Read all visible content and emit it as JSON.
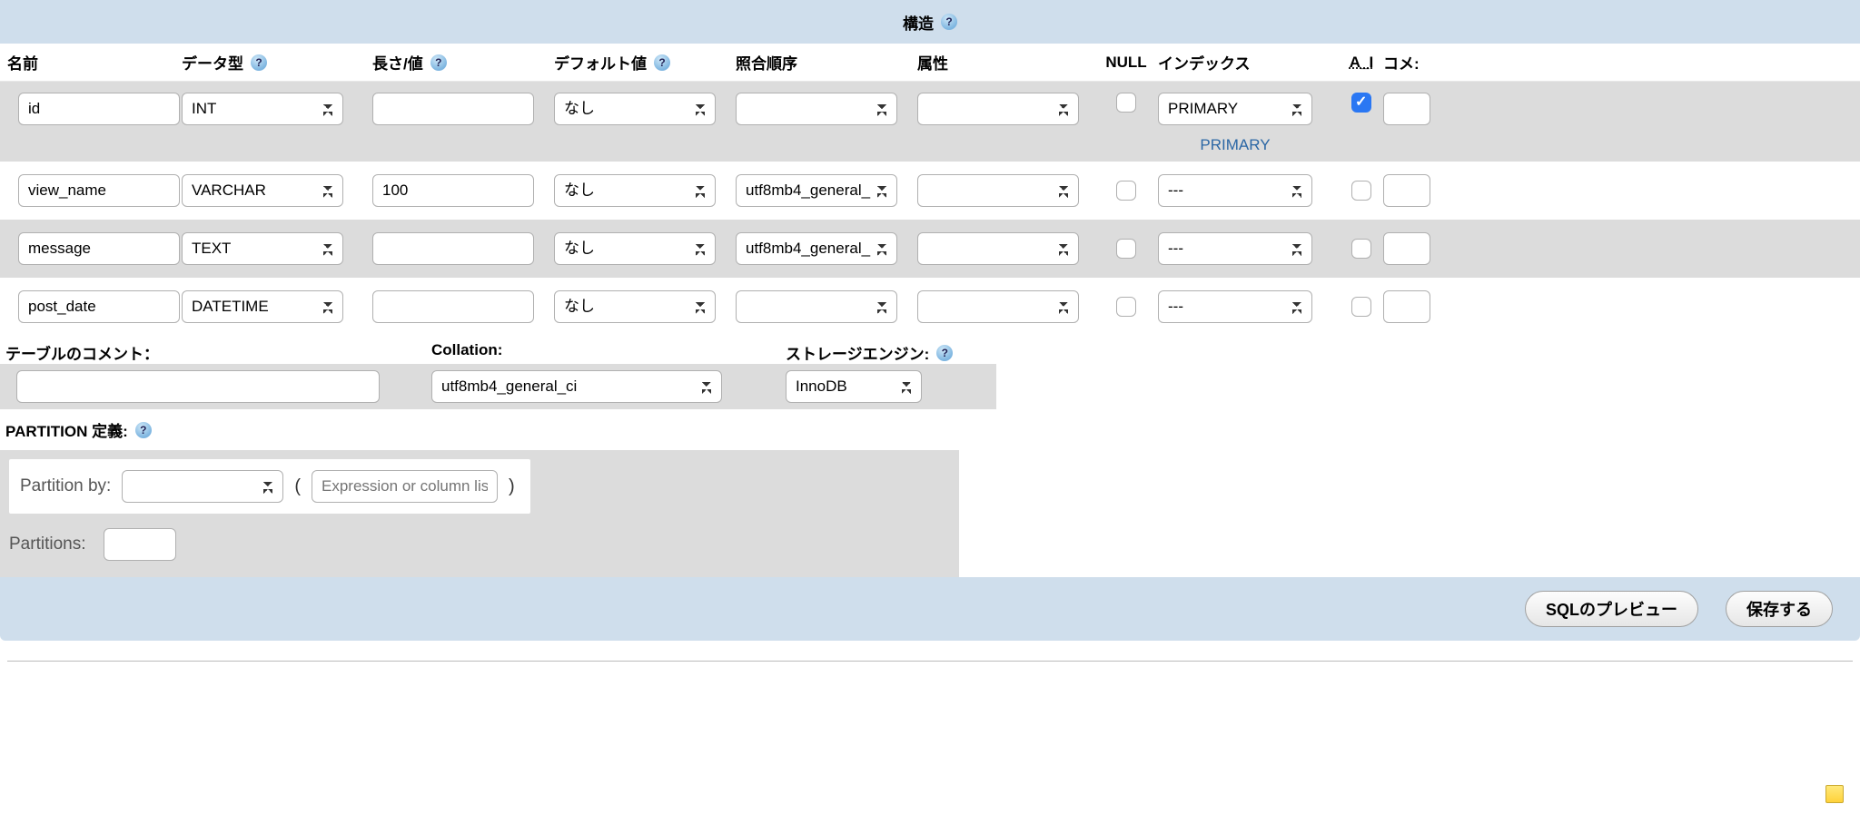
{
  "labels": {
    "structure": "構造",
    "name": "名前",
    "type": "データ型",
    "length": "長さ/値",
    "default": "デフォルト値",
    "collation": "照合順序",
    "attributes": "属性",
    "null": "NULL",
    "index": "インデックス",
    "ai": "A_I",
    "comment": "コメ:",
    "table_comment": "テーブルのコメント：",
    "collation_label": "Collation:",
    "storage_engine": "ストレージエンジン:",
    "partition_title": "PARTITION 定義:",
    "partition_by": "Partition by:",
    "partitions": "Partitions:",
    "sql_preview": "SQLのプレビュー",
    "save": "保存する",
    "expr_placeholder": "Expression or column lis",
    "primary_badge": "PRIMARY"
  },
  "help_glyph": "?",
  "rows": [
    {
      "name": "id",
      "type": "INT",
      "length": "",
      "default": "なし",
      "collation": "",
      "attr": "",
      "null": false,
      "index": "PRIMARY",
      "ai": true,
      "primary_badge": true
    },
    {
      "name": "view_name",
      "type": "VARCHAR",
      "length": "100",
      "default": "なし",
      "collation": "utf8mb4_general_",
      "attr": "",
      "null": false,
      "index": "---",
      "ai": false
    },
    {
      "name": "message",
      "type": "TEXT",
      "length": "",
      "default": "なし",
      "collation": "utf8mb4_general_",
      "attr": "",
      "null": false,
      "index": "---",
      "ai": false
    },
    {
      "name": "post_date",
      "type": "DATETIME",
      "length": "",
      "default": "なし",
      "collation": "",
      "attr": "",
      "null": false,
      "index": "---",
      "ai": false
    }
  ],
  "meta": {
    "table_comment": "",
    "collation": "utf8mb4_general_ci",
    "engine": "InnoDB"
  },
  "partition": {
    "by": "",
    "expr": "",
    "count": "",
    "paren_open": "(",
    "paren_close": ")"
  }
}
